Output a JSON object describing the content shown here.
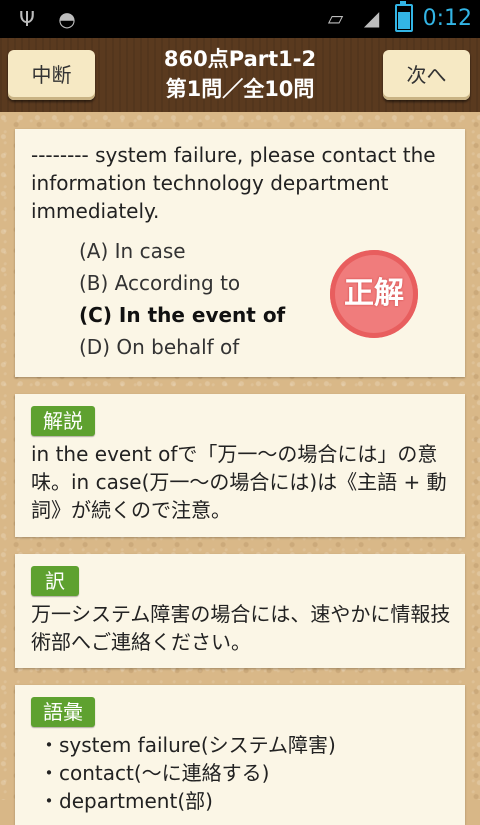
{
  "status_bar": {
    "time": "0:12",
    "icons": [
      "usb-icon",
      "android-icon",
      "rotate-icon",
      "signal-icon",
      "battery-icon"
    ]
  },
  "header": {
    "left_button": "中断",
    "title_line1": "860点Part1-2",
    "title_line2": "第1問／全10問",
    "right_button": "次へ"
  },
  "question": {
    "text": "-------- system failure, please contact the information technology department immediately.",
    "choices": [
      "(A) In case",
      "(B) According to",
      "(C) In the event of",
      "(D) On behalf of"
    ],
    "correct_index": 2,
    "stamp": "正解"
  },
  "explanation": {
    "label": "解説",
    "text": "in the event ofで「万一～の場合には」の意味。in case(万一～の場合には)は《主語 + 動詞》が続くので注意。"
  },
  "translation": {
    "label": "訳",
    "text": "万一システム障害の場合には、速やかに情報技術部へご連絡ください。"
  },
  "vocabulary": {
    "label": "語彙",
    "items": [
      "・system failure(システム障害)",
      "・contact(～に連絡する)",
      "・department(部)"
    ]
  },
  "colors": {
    "header_bg": "#5a3a1f",
    "label_green": "#5ea12f",
    "stamp_red": "#f07c7c",
    "card_bg": "#fbf6e6",
    "time_blue": "#33b5e5"
  }
}
